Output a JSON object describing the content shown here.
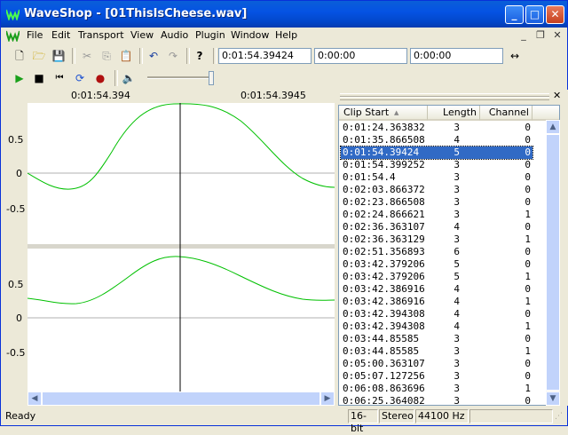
{
  "window": {
    "title": "WaveShop - [01ThisIsCheese.wav]"
  },
  "menu": [
    "File",
    "Edit",
    "Transport",
    "View",
    "Audio",
    "Plugin",
    "Window",
    "Help"
  ],
  "time_fields": {
    "position": "0:01:54.39424",
    "selection_start": "0:00:00",
    "selection_length": "0:00:00"
  },
  "ruler": {
    "left_label": "0:01:54.394",
    "right_label": "0:01:54.3945"
  },
  "channel1_axis": [
    "0.5",
    "0",
    "-0.5"
  ],
  "channel2_axis": [
    "0.5",
    "0",
    "-0.5"
  ],
  "list": {
    "columns": [
      "Clip Start",
      "Length",
      "Channel"
    ],
    "rows": [
      {
        "start": "0:01:24.363832",
        "length": "3",
        "channel": "0"
      },
      {
        "start": "0:01:35.866508",
        "length": "4",
        "channel": "0"
      },
      {
        "start": "0:01:54.39424",
        "length": "5",
        "channel": "0",
        "selected": true
      },
      {
        "start": "0:01:54.399252",
        "length": "3",
        "channel": "0"
      },
      {
        "start": "0:01:54.4",
        "length": "3",
        "channel": "0"
      },
      {
        "start": "0:02:03.866372",
        "length": "3",
        "channel": "0"
      },
      {
        "start": "0:02:23.866508",
        "length": "3",
        "channel": "0"
      },
      {
        "start": "0:02:24.866621",
        "length": "3",
        "channel": "1"
      },
      {
        "start": "0:02:36.363107",
        "length": "4",
        "channel": "0"
      },
      {
        "start": "0:02:36.363129",
        "length": "3",
        "channel": "1"
      },
      {
        "start": "0:02:51.356893",
        "length": "6",
        "channel": "0"
      },
      {
        "start": "0:03:42.379206",
        "length": "5",
        "channel": "0"
      },
      {
        "start": "0:03:42.379206",
        "length": "5",
        "channel": "1"
      },
      {
        "start": "0:03:42.386916",
        "length": "4",
        "channel": "0"
      },
      {
        "start": "0:03:42.386916",
        "length": "4",
        "channel": "1"
      },
      {
        "start": "0:03:42.394308",
        "length": "4",
        "channel": "0"
      },
      {
        "start": "0:03:42.394308",
        "length": "4",
        "channel": "1"
      },
      {
        "start": "0:03:44.85585",
        "length": "3",
        "channel": "0"
      },
      {
        "start": "0:03:44.85585",
        "length": "3",
        "channel": "1"
      },
      {
        "start": "0:05:00.363107",
        "length": "3",
        "channel": "0"
      },
      {
        "start": "0:05:07.127256",
        "length": "3",
        "channel": "0"
      },
      {
        "start": "0:06:08.863696",
        "length": "3",
        "channel": "1"
      },
      {
        "start": "0:06:25.364082",
        "length": "3",
        "channel": "0"
      }
    ]
  },
  "status": {
    "message": "Ready",
    "bits": "16-bit",
    "channels": "Stereo",
    "rate": "44100 Hz"
  },
  "colors": {
    "waveform": "#00c000",
    "selection": "#316ac5",
    "titlebar": "#0553e3"
  }
}
